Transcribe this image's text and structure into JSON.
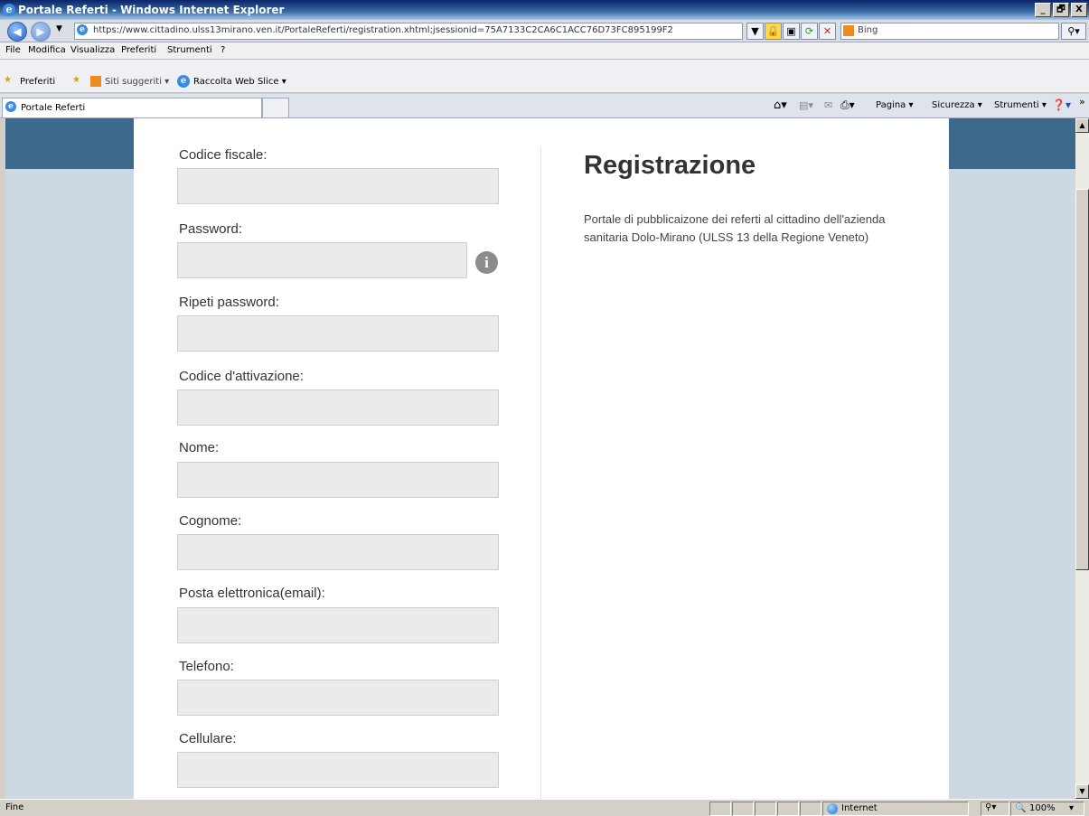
{
  "window": {
    "title": "Portale Referti - Windows Internet Explorer",
    "url": "https://www.cittadino.ulss13mirano.ven.it/PortaleReferti/registration.xhtml;jsessionid=75A7133C2CA6C1ACC76D73FC895199F2",
    "search_placeholder": "Bing",
    "controls": {
      "minimize": "_",
      "maximize": "🗗",
      "close": "X"
    }
  },
  "menu": [
    "File",
    "Modifica",
    "Visualizza",
    "Preferiti",
    "Strumenti",
    "?"
  ],
  "favorites": {
    "label": "Preferiti",
    "suggested": "Siti suggeriti ▾",
    "webslice": "Raccolta Web Slice ▾"
  },
  "tab": {
    "label": "Portale Referti"
  },
  "commandbar": {
    "page": "Pagina ▾",
    "security": "Sicurezza ▾",
    "tools": "Strumenti ▾",
    "more": "»"
  },
  "form": {
    "fields": [
      {
        "label": "Codice fiscale:",
        "value": ""
      },
      {
        "label": "Password:",
        "value": ""
      },
      {
        "label": "Ripeti password:",
        "value": ""
      },
      {
        "label": "Codice d'attivazione:",
        "value": ""
      },
      {
        "label": "Nome:",
        "value": ""
      },
      {
        "label": "Cognome:",
        "value": ""
      },
      {
        "label": "Posta elettronica(email):",
        "value": ""
      },
      {
        "label": "Telefono:",
        "value": ""
      },
      {
        "label": "Cellulare:",
        "value": ""
      }
    ]
  },
  "info": {
    "title": "Registrazione",
    "description": "Portale di pubblicaizone dei referti al cittadino dell'azienda sanitaria Dolo-Mirano (ULSS 13 della Regione Veneto)"
  },
  "status": {
    "text": "Fine",
    "zone": "Internet",
    "zoom": "100%"
  },
  "colors": {
    "header_band": "#3d6a8c",
    "page_background": "#ccd9e2",
    "input_background": "#ebebeb"
  }
}
